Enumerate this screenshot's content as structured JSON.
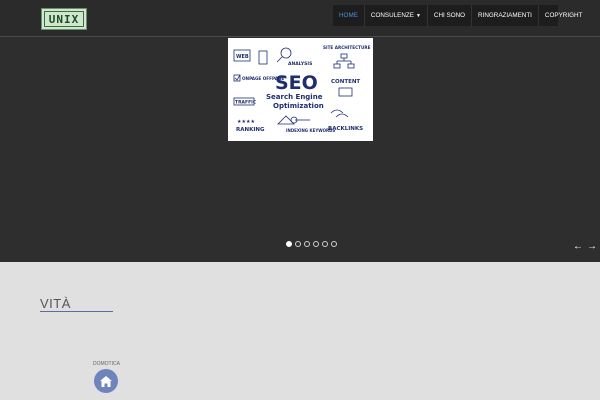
{
  "header": {
    "logo_text": "UNIX",
    "nav": [
      {
        "label": "HOME",
        "active": true,
        "dropdown": false
      },
      {
        "label": "CONSULENZE",
        "active": false,
        "dropdown": true
      },
      {
        "label": "CHI SONO",
        "active": false,
        "dropdown": false
      },
      {
        "label": "RINGRAZIAMENTI",
        "active": false,
        "dropdown": false
      },
      {
        "label": "COPYRIGHT",
        "active": false,
        "dropdown": false
      }
    ]
  },
  "slider": {
    "slide_text": {
      "web": "WEB",
      "analysis": "ANALYSIS",
      "site_architecture": "SITE ARCHITECTURE",
      "onpage_offpage": "ONPAGE OFFPAGE",
      "seo": "SEO",
      "search_engine": "Search Engine",
      "optimization": "Optimization",
      "content": "CONTENT",
      "traffic": "TRAFFIC",
      "ranking": "RANKING",
      "indexing_keywords": "INDEXING KEYWORDS",
      "backlinks": "BACKLINKS"
    },
    "dot_count": 6,
    "active_dot": 0,
    "prev_arrow": "←",
    "next_arrow": "→"
  },
  "section": {
    "title": "VITÀ",
    "items": [
      {
        "label": "DOMOTICA",
        "icon": "home-icon"
      }
    ]
  },
  "colors": {
    "hero_bg": "#2e2e2e",
    "nav_bg": "#1d1d1d",
    "nav_active": "#4f8fe0",
    "accent": "#6e84ba",
    "seo_blue": "#1f2f6e"
  }
}
